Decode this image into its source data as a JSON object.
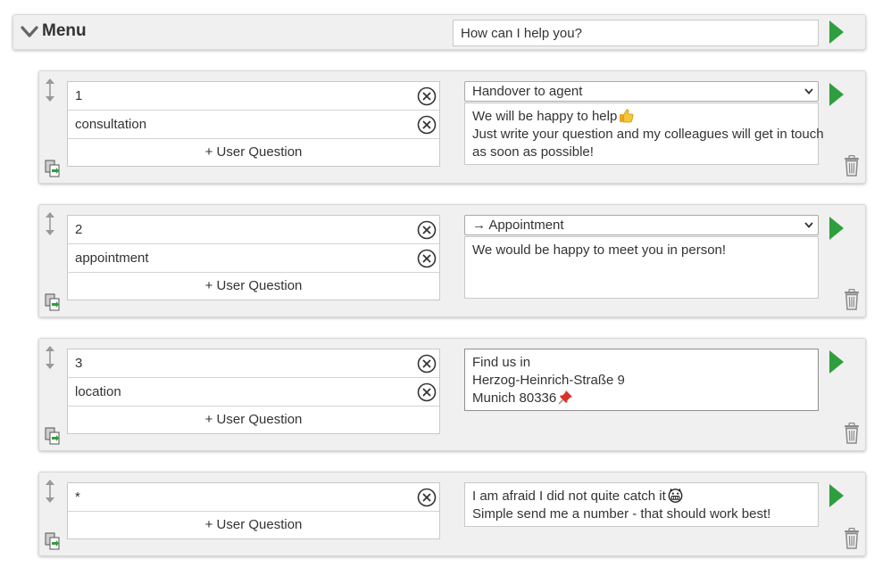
{
  "menu": {
    "title": "Menu",
    "greeting": "How can I help you?"
  },
  "add_question_label": "+ User Question",
  "entries": [
    {
      "questions": [
        "1",
        "consultation"
      ],
      "action": "Handover to agent",
      "response": [
        "We will be happy to help",
        "Just write your question and my colleagues will get in touch",
        "as soon as possible!"
      ]
    },
    {
      "questions": [
        "2",
        "appointment"
      ],
      "action": "→ Appointment",
      "response": [
        "We would be happy to meet you in person!"
      ]
    },
    {
      "questions": [
        "3",
        "location"
      ],
      "response": [
        "Find us in",
        "Herzog-Heinrich-Straße 9",
        "Munich 80336"
      ]
    },
    {
      "questions": [
        "*"
      ],
      "response": [
        "I am afraid I did not quite catch it",
        "Simple send me a number - that should work best!"
      ]
    }
  ],
  "colors": {
    "play": "#2e9e3e",
    "panel": "#f0f0f0"
  }
}
